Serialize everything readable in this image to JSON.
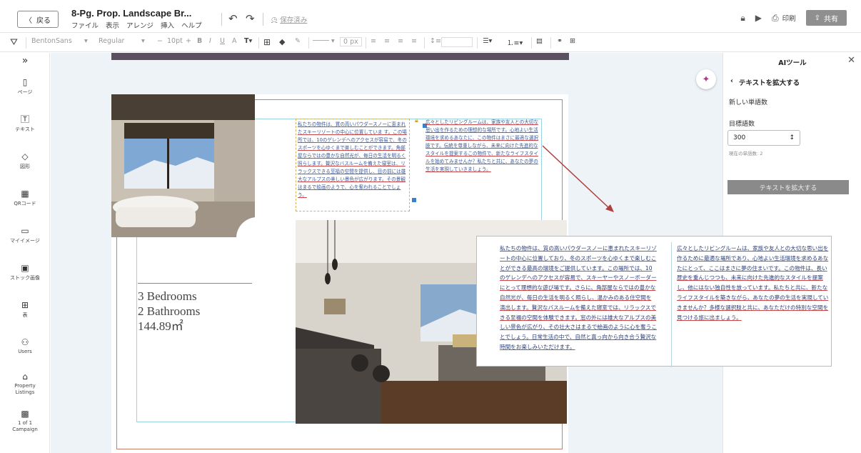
{
  "header": {
    "back_label": "戻る",
    "doc_title": "8-Pg. Prop. Landscape Br...",
    "menu": [
      "ファイル",
      "表示",
      "アレンジ",
      "挿入",
      "ヘルプ"
    ],
    "saved_status": "保存済み",
    "print_label": "印刷",
    "share_label": "共有"
  },
  "toolbar": {
    "font_family": "BentonSans",
    "font_weight": "Regular",
    "font_size": "10pt",
    "stroke_size": "0 px"
  },
  "sidebar": {
    "items": [
      {
        "label": "ページ",
        "icon": "page-icon"
      },
      {
        "label": "テキスト",
        "icon": "text-icon"
      },
      {
        "label": "図形",
        "icon": "shapes-icon"
      },
      {
        "label": "QRコード",
        "icon": "qr-icon"
      },
      {
        "label": "マイイメージ",
        "icon": "folder-icon"
      },
      {
        "label": "ストック画像",
        "icon": "image-icon"
      },
      {
        "label": "表",
        "icon": "table-icon"
      },
      {
        "label": "Users",
        "icon": "user-icon"
      },
      {
        "label": "Property Listings",
        "icon": "home-icon"
      },
      {
        "label": "1 of 1 Campaign",
        "icon": "campaign-icon"
      }
    ]
  },
  "page": {
    "specs": [
      "3 Bedrooms",
      "2 Bathrooms",
      "144.89㎡"
    ],
    "text_box1": "私たちの物件は、質の高いパウダースノーに恵まれたスキーリゾートの中心に位置していま す。この場所では、10のゲレンデへのアクセスが容易で、冬のスポーツを心ゆくまで楽しむことができます。角部屋ならではの豊かな自然光が、毎日の生活を明るく照らします。贅沢なバスルームを備えた寝室は、リラックスできる至福の空間を提供し、目の前には雄大なアルプスの美しい景色が広がります。その景観はまるで絵画のようで、心を奪われることでしょう。",
    "text_box2": "広々としたリビングルームは、家族や友人との大切な思い出を作るための理想的な場所です。心地よい生活環境を求めるあなたに、この物件はまさに最適な選択肢です。伝統を尊重しながら、未来に向けた先進的なスタイルを提案するこの物件で、新たなライフスタイルを始めてみませんか？私たちと共に、あなたの夢の生活を実現していきましょう。"
  },
  "zoom": {
    "col1": "私たちの物件は、質の高いパウダースノーに恵まれたスキーリゾートの中心に位置しており、冬のスポーツを心ゆくまで楽しむことができる最高の環境をご提供しています。この場所では、10のゲレンデへのアクセスが容易で、スキーヤーやスノーボーダーにとって理想的な遊び場です。さらに、角部屋ならではの豊かな自然光が、毎日の生活を明るく照らし、温かみのある住空間を演出します。贅沢なバスルームを備えた寝室では、リラックスできる至福の空間を体験できます。窓の外には雄大なアルプスの美しい景色が広がり、その壮大さはまるで絵画のように心を奪うことでしょう。日常生活の中で、自然と真っ向から向き合う贅沢な時間をお楽しみいただけます。",
    "col2": "広々としたリビングルームは、家族や友人との大切な思い出を作るために最適な場所であり、心地よい生活環境を求めるあなたにとって、ここはまさに夢の住まいです。この物件は、長い歴史を重んじつつも、未来に向けた先進的なスタイルを提案し、他にはない独自性を放っています。私たちと共に、新たなライフスタイルを築きながら、あなたの夢の生活を実現していきませんか？多様な選択肢と共に、あなただけの特別な空間を見つける旅に出ましょう。"
  },
  "ai_panel": {
    "title": "AIツール",
    "back_label": "テキストを拡大する",
    "subhead": "新しい単語数",
    "target_label": "目標語数",
    "target_value": "300",
    "hint": "現在の単語数: 2",
    "expand_button": "テキストを拡大する"
  },
  "colors": {
    "accent_border": "#c9806a",
    "guide": "#9bd3e0",
    "arrow": "#b04040",
    "share_button": "#8f8f8f"
  }
}
